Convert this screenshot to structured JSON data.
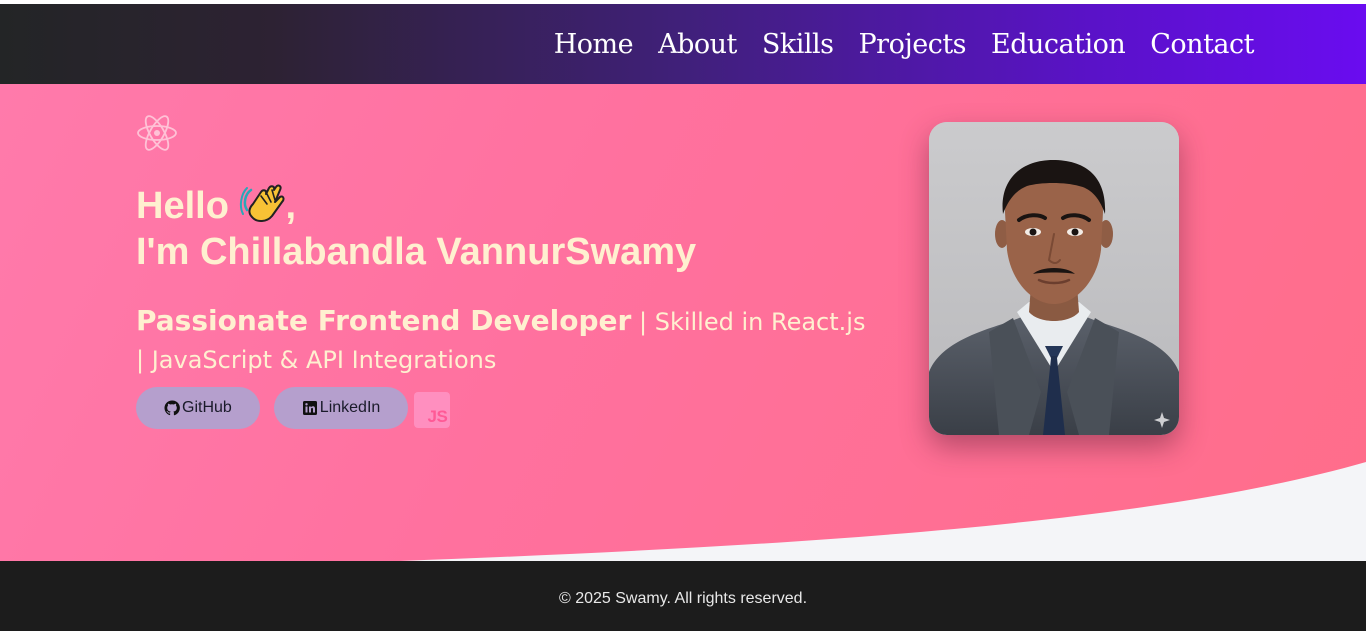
{
  "nav": {
    "items": [
      {
        "label": "Home"
      },
      {
        "label": "About"
      },
      {
        "label": "Skills"
      },
      {
        "label": "Projects"
      },
      {
        "label": "Education"
      },
      {
        "label": "Contact"
      }
    ]
  },
  "hero": {
    "icon": "react-atom-icon",
    "greeting_line1": "Hello",
    "greeting_emoji": "waving-hand-icon",
    "greeting_comma": ",",
    "greeting_line2": "I'm Chillabandla VannurSwamy",
    "tagline_strong": "Passionate Frontend Developer",
    "tagline_rest": " | Skilled in React.js | JavaScript & API Integrations",
    "buttons": [
      {
        "label": "GitHub",
        "icon": "github-icon"
      },
      {
        "label": "LinkedIn",
        "icon": "linkedin-icon"
      }
    ],
    "js_badge": "JS",
    "photo": "profile-photo",
    "photo_badge_icon": "sparkle-icon"
  },
  "footer": {
    "copyright": "© 2025 Swamy. All rights reserved."
  },
  "colors": {
    "nav_start": "#232526",
    "nav_end": "#6a0cf0",
    "hero_bg": "#ff719f",
    "hero_text": "#fff0d0",
    "button_bg": "#b59fcd",
    "wave_bg": "#f4f5f8",
    "footer_bg": "#1c1c1c"
  }
}
